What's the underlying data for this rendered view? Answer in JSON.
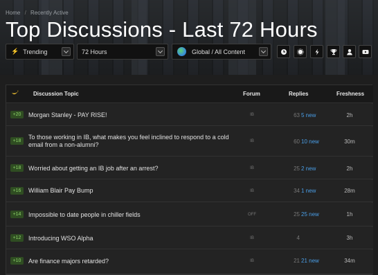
{
  "breadcrumb": [
    "Home",
    "Recently Active"
  ],
  "page_title": "Top Discussions - Last 72 Hours",
  "filters": {
    "sort": "Trending",
    "timeframe": "72 Hours",
    "scope": "Global / All Content"
  },
  "toolbar_icons": [
    "clock-icon",
    "star-icon",
    "bolt-icon",
    "trophy-icon",
    "user-icon",
    "video-icon"
  ],
  "table": {
    "headers": {
      "topic": "Discussion Topic",
      "forum": "Forum",
      "replies": "Replies",
      "freshness": "Freshness"
    },
    "rows": [
      {
        "score": "+20",
        "title": "Morgan Stanley - PAY RISE!",
        "forum": "IB",
        "replies": "63",
        "new": "5 new",
        "fresh": "2h"
      },
      {
        "score": "+18",
        "title": "To those working in IB, what makes you feel inclined to respond to a cold email from a non-alumni?",
        "forum": "IB",
        "replies": "60",
        "new": "10 new",
        "fresh": "30m"
      },
      {
        "score": "+18",
        "title": "Worried about getting an IB job after an arrest?",
        "forum": "IB",
        "replies": "25",
        "new": "2 new",
        "fresh": "2h"
      },
      {
        "score": "+16",
        "title": "William Blair Pay Bump",
        "forum": "IB",
        "replies": "34",
        "new": "1 new",
        "fresh": "28m"
      },
      {
        "score": "+14",
        "title": "Impossible to date people in chiller fields",
        "forum": "OFF",
        "replies": "25",
        "new": "25 new",
        "fresh": "1h"
      },
      {
        "score": "+12",
        "title": "Introducing WSO Alpha",
        "forum": "IB",
        "replies": "4",
        "new": "",
        "fresh": "3h"
      },
      {
        "score": "+10",
        "title": "Are finance majors retarded?",
        "forum": "IB",
        "replies": "21",
        "new": "21 new",
        "fresh": "34m"
      }
    ]
  }
}
